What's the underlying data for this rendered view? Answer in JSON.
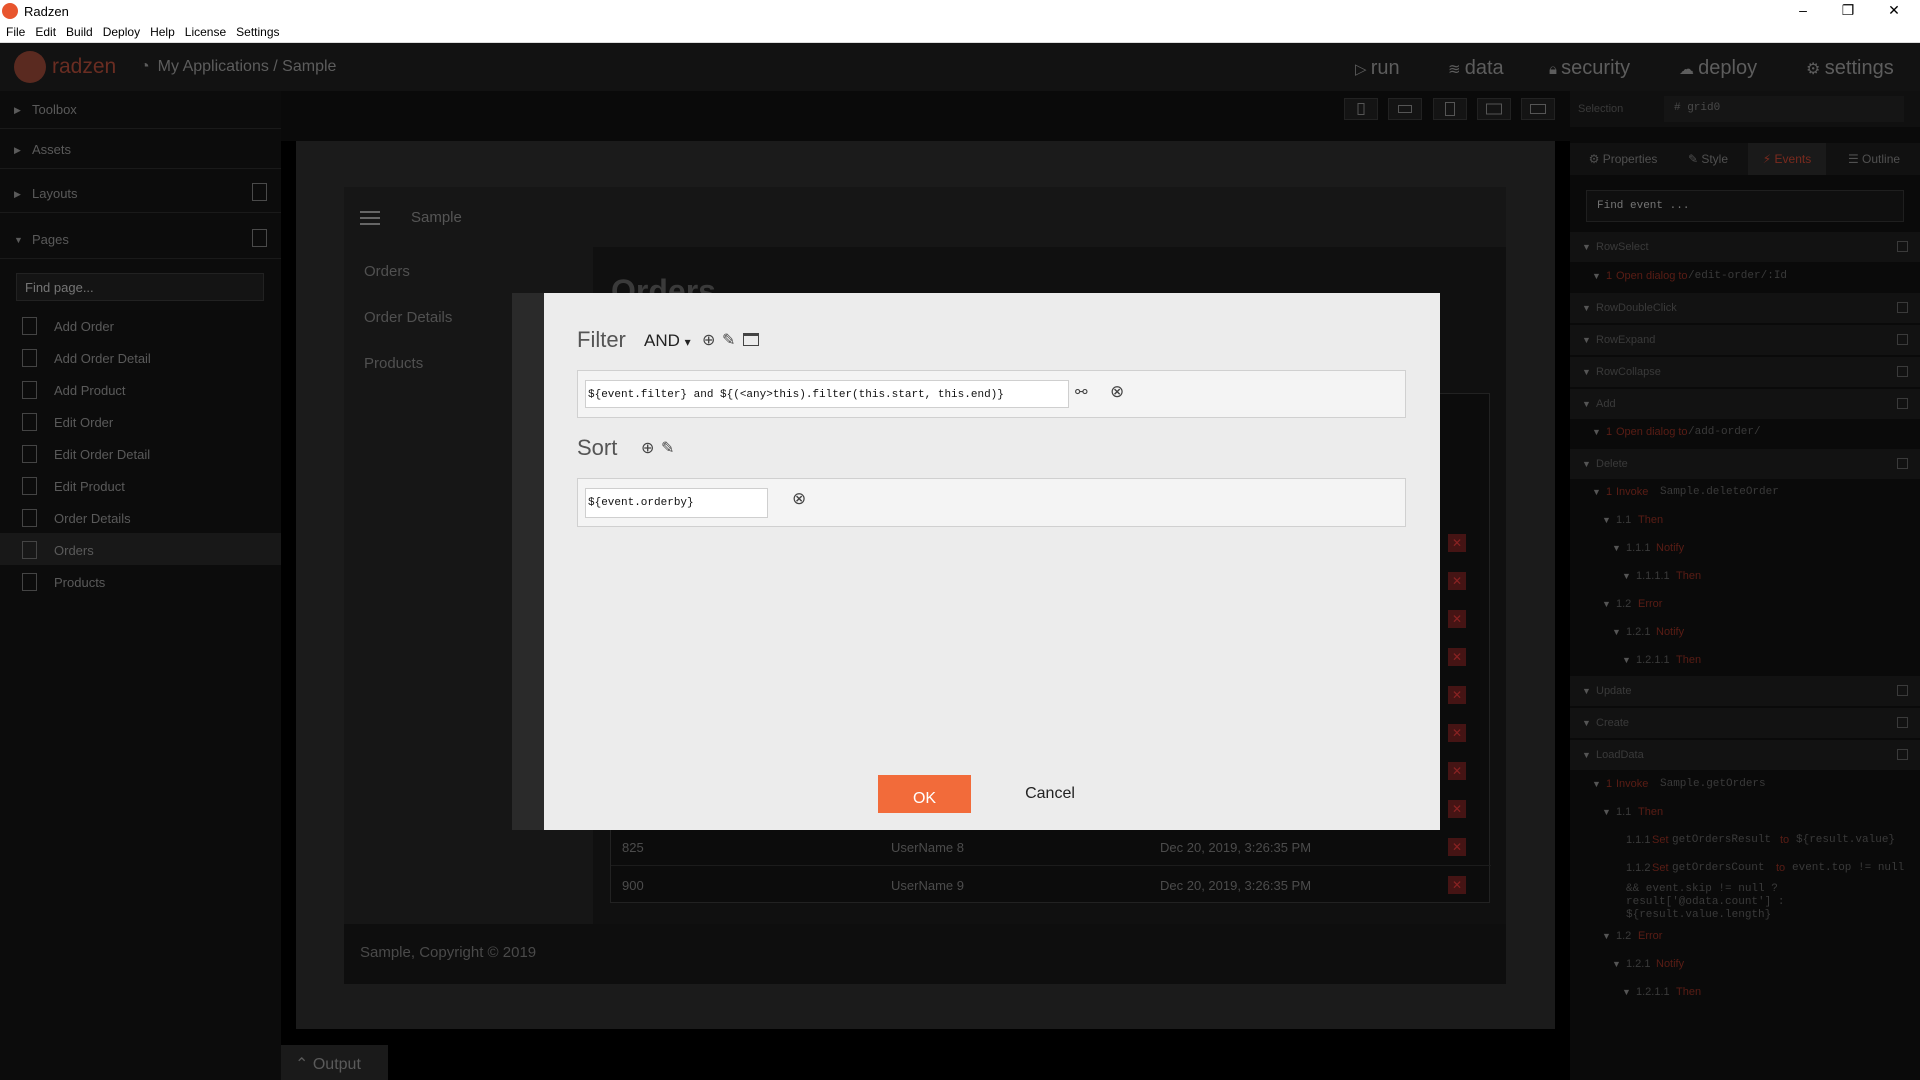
{
  "window": {
    "title": "Radzen",
    "minimize": "–",
    "maximize": "❐",
    "close": "✕"
  },
  "menu": [
    "File",
    "Edit",
    "Build",
    "Deploy",
    "Help",
    "License",
    "Settings"
  ],
  "appbar": {
    "brand": "radzen",
    "breadcrumb": "My Applications / Sample",
    "nav": [
      {
        "label": "run",
        "icon": "play-icon"
      },
      {
        "label": "data",
        "icon": "database-icon"
      },
      {
        "label": "security",
        "icon": "lock-icon"
      },
      {
        "label": "deploy",
        "icon": "cloud-icon"
      },
      {
        "label": "settings",
        "icon": "gear-icon"
      }
    ]
  },
  "left": {
    "sections": [
      "Toolbox",
      "Assets",
      "Layouts",
      "Pages"
    ],
    "find_placeholder": "Find page...",
    "pages": [
      "Add Order",
      "Add Order Detail",
      "Add Product",
      "Edit Order",
      "Edit Order Detail",
      "Edit Product",
      "Order Details",
      "Orders",
      "Products"
    ],
    "selected_page": "Orders"
  },
  "preview": {
    "app_title": "Sample",
    "side_items": [
      "Orders",
      "Order Details",
      "Products"
    ],
    "page_title": "Orders",
    "rows": [
      {
        "id": "825",
        "user": "UserName 8",
        "date": "Dec 20, 2019, 3:26:35 PM"
      },
      {
        "id": "900",
        "user": "UserName 9",
        "date": "Dec 20, 2019, 3:26:35 PM"
      }
    ],
    "footer": "Sample, Copyright © 2019"
  },
  "right": {
    "selection_label": "Selection",
    "selection_value": "# grid0",
    "tabs": [
      "Properties",
      "Style",
      "Events",
      "Outline"
    ],
    "active_tab": "Events",
    "find_placeholder": "Find event ...",
    "events": {
      "rowselect": "RowSelect",
      "rowselect_1": "1",
      "rowselect_1_action": "Open dialog to",
      "rowselect_1_target": "/edit-order/:Id",
      "rowdoubleclick": "RowDoubleClick",
      "rowexpand": "RowExpand",
      "rowcollapse": "RowCollapse",
      "add": "Add",
      "add_1": "1",
      "add_1_action": "Open dialog to",
      "add_1_target": "/add-order/",
      "delete": "Delete",
      "delete_1": "1",
      "delete_1_action": "Invoke",
      "delete_1_target": "Sample.deleteOrder",
      "d_11": "1.1",
      "d_11_then": "Then",
      "d_111": "1.1.1",
      "d_111_notify": "Notify",
      "d_1111": "1.1.1.1",
      "d_1111_then": "Then",
      "d_12": "1.2",
      "d_12_error": "Error",
      "d_121": "1.2.1",
      "d_121_notify": "Notify",
      "d_1211": "1.2.1.1",
      "d_1211_then": "Then",
      "update": "Update",
      "create": "Create",
      "loaddata": "LoadData",
      "ld_1": "1",
      "ld_1_action": "Invoke",
      "ld_1_target": "Sample.getOrders",
      "ld_11": "1.1",
      "ld_11_then": "Then",
      "ld_111": "1.1.1",
      "ld_111_set": "Set",
      "ld_111_var": "getOrdersResult",
      "ld_111_to": "to",
      "ld_111_val": "${result.value}",
      "ld_112": "1.1.2",
      "ld_112_set": "Set",
      "ld_112_var": "getOrdersCount",
      "ld_112_if": "to",
      "ld_112_val1": "event.top != null",
      "ld_112_val2": "&& event.skip != null ?",
      "ld_112_val3": "result['@odata.count'] :",
      "ld_112_val4": "${result.value.length}",
      "ld_12": "1.2",
      "ld_12_error": "Error",
      "ld_121": "1.2.1",
      "ld_121_notify": "Notify",
      "ld_1211": "1.2.1.1",
      "ld_1211_then": "Then"
    }
  },
  "output_tab": "Output",
  "dialog": {
    "filter_label": "Filter",
    "operator": "AND",
    "operator_caret": "▾",
    "filter_expression": "${event.filter} and ${(<any>this).filter(this.start, this.end)}",
    "sort_label": "Sort",
    "sort_expression": "${event.orderby}",
    "ok_label": "OK",
    "cancel_label": "Cancel",
    "accent_color": "#f26b3a"
  }
}
